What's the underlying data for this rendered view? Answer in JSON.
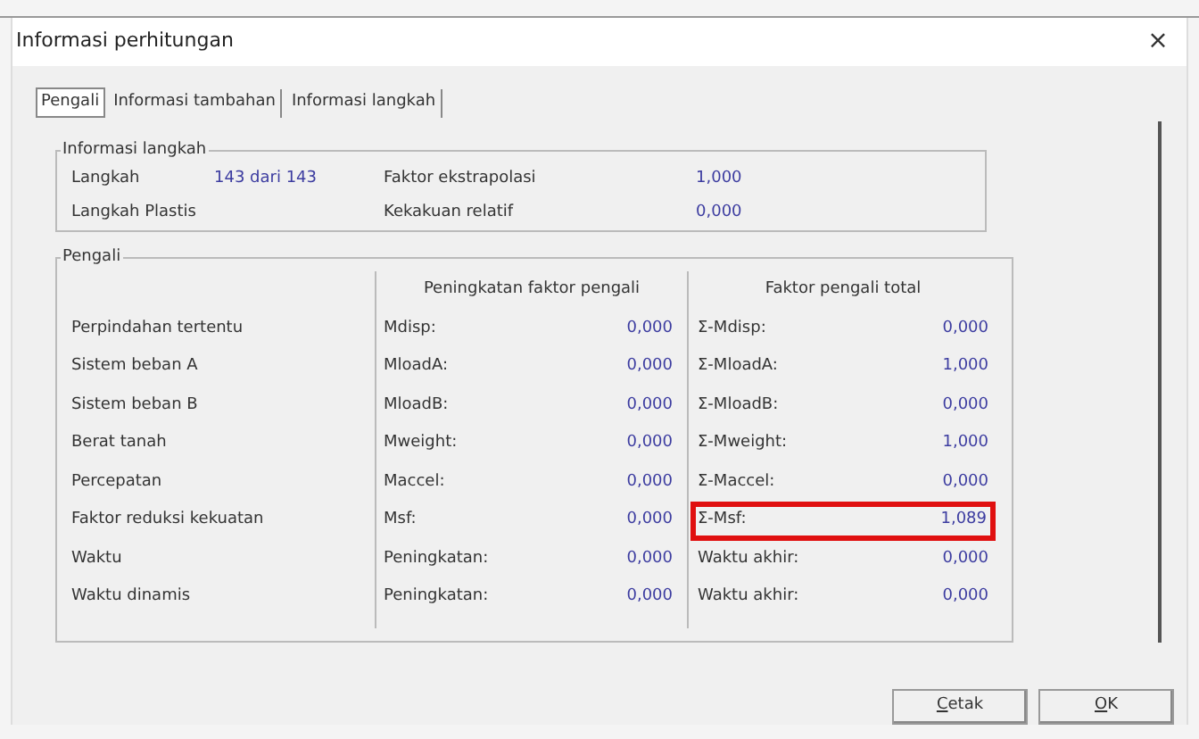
{
  "window": {
    "title": "Informasi perhitungan",
    "close": "×"
  },
  "tabs": [
    {
      "label": "Pengali",
      "selected": true
    },
    {
      "label": "Informasi tambahan",
      "selected": false
    },
    {
      "label": "Informasi langkah",
      "selected": false
    }
  ],
  "step_info": {
    "title": "Informasi langkah",
    "rows": [
      {
        "label": "Langkah",
        "value": "143 dari 143",
        "label_2": "Faktor ekstrapolasi",
        "value_2": "1,000"
      },
      {
        "label": "Langkah Plastis",
        "label_2": "Kekakuan relatif",
        "value_2": "0,000"
      }
    ]
  },
  "multipliers": {
    "title": "Pengali",
    "increment_heading": "Peningkatan faktor pengali",
    "total_heading": "Faktor pengali total",
    "rows": [
      {
        "label": "Perpindahan tertentu",
        "inc_label": "Mdisp:",
        "inc_value": "0,000",
        "total_label": "Σ-Mdisp:",
        "total_value": "0,000",
        "highlighted": false
      },
      {
        "label": "Sistem beban A",
        "inc_label": "MloadA:",
        "inc_value": "0,000",
        "total_label": "Σ-MloadA:",
        "total_value": "1,000",
        "highlighted": false
      },
      {
        "label": "Sistem beban B",
        "inc_label": "MloadB:",
        "inc_value": "0,000",
        "total_label": "Σ-MloadB:",
        "total_value": "0,000",
        "highlighted": false
      },
      {
        "label": "Berat tanah",
        "inc_label": "Mweight:",
        "inc_value": "0,000",
        "total_label": "Σ-Mweight:",
        "total_value": "1,000",
        "highlighted": false
      },
      {
        "label": "Percepatan",
        "inc_label": "Maccel:",
        "inc_value": "0,000",
        "total_label": "Σ-Maccel:",
        "total_value": "0,000",
        "highlighted": false
      },
      {
        "label": "Faktor reduksi kekuatan",
        "inc_label": "Msf:",
        "inc_value": "0,000",
        "total_label": "Σ-Msf:",
        "total_value": "1,089",
        "highlighted": true
      },
      {
        "label": "Waktu",
        "inc_label": "Peningkatan:",
        "inc_value": "0,000",
        "total_label": "Waktu akhir:",
        "total_value": "0,000",
        "highlighted": false
      },
      {
        "label": "Waktu dinamis",
        "inc_label": "Peningkatan:",
        "inc_value": "0,000",
        "total_label": "Waktu akhir:",
        "total_value": "0,000",
        "highlighted": false
      }
    ]
  },
  "buttons": [
    "Cetak",
    "OK"
  ]
}
